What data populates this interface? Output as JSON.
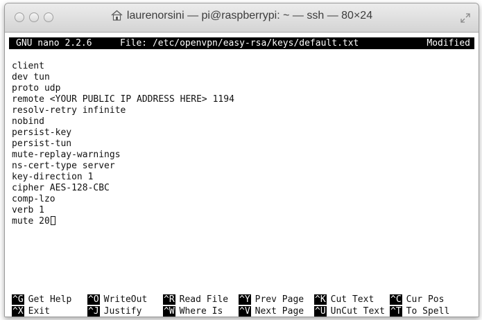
{
  "window": {
    "title": "laurenorsini — pi@raspberrypi: ~ — ssh — 80×24"
  },
  "nano": {
    "version": "GNU nano 2.2.6",
    "file_label": "File: /etc/openvpn/easy-rsa/keys/default.txt",
    "state": "Modified"
  },
  "buffer_lines": [
    "client",
    "dev tun",
    "proto udp",
    "remote <YOUR PUBLIC IP ADDRESS HERE> 1194",
    "resolv-retry infinite",
    "nobind",
    "persist-key",
    "persist-tun",
    "mute-replay-warnings",
    "ns-cert-type server",
    "key-direction 1",
    "cipher AES-128-CBC",
    "comp-lzo",
    "verb 1",
    "mute 20"
  ],
  "shortcuts": {
    "row1": [
      {
        "key": "^G",
        "label": "Get Help"
      },
      {
        "key": "^O",
        "label": "WriteOut"
      },
      {
        "key": "^R",
        "label": "Read File"
      },
      {
        "key": "^Y",
        "label": "Prev Page"
      },
      {
        "key": "^K",
        "label": "Cut Text"
      },
      {
        "key": "^C",
        "label": "Cur Pos"
      }
    ],
    "row2": [
      {
        "key": "^X",
        "label": "Exit"
      },
      {
        "key": "^J",
        "label": "Justify"
      },
      {
        "key": "^W",
        "label": "Where Is"
      },
      {
        "key": "^V",
        "label": "Next Page"
      },
      {
        "key": "^U",
        "label": "UnCut Text"
      },
      {
        "key": "^T",
        "label": "To Spell"
      }
    ]
  }
}
